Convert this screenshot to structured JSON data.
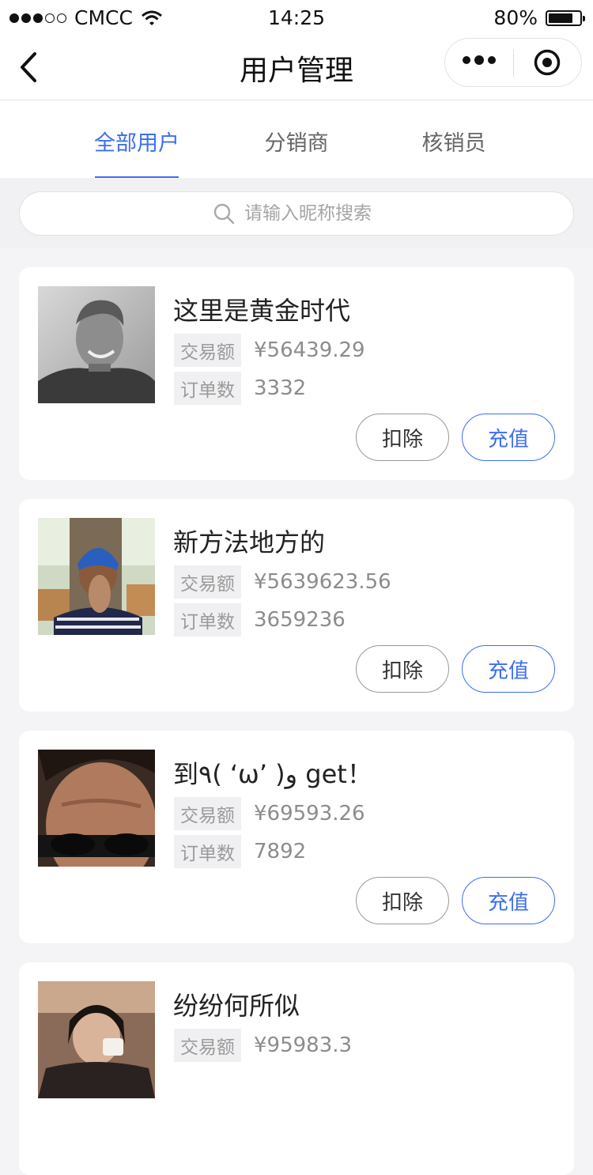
{
  "status_bar": {
    "carrier": "CMCC",
    "time": "14:25",
    "battery": "80%",
    "battery_level": 0.8
  },
  "nav": {
    "title": "用户管理",
    "back_icon": "chevron-left-icon",
    "more_icon": "more-dots-icon",
    "close_icon": "target-circle-icon"
  },
  "tabs": [
    {
      "label": "全部用户",
      "active": true
    },
    {
      "label": "分销商",
      "active": false
    },
    {
      "label": "核销员",
      "active": false
    }
  ],
  "search": {
    "placeholder": "请输入昵称搜索",
    "icon": "search-icon"
  },
  "labels": {
    "amount": "交易额",
    "orders": "订单数",
    "deduct": "扣除",
    "recharge": "充值"
  },
  "users": [
    {
      "name": "这里是黄金时代",
      "amount": "¥56439.29",
      "orders": "3332"
    },
    {
      "name": "新方法地方的",
      "amount": "¥5639623.56",
      "orders": "3659236"
    },
    {
      "name": "到٩( ‘ω’ )و get！",
      "amount": "¥69593.26",
      "orders": "7892"
    },
    {
      "name": "纷纷何所似",
      "amount": "¥95983.3",
      "orders": ""
    }
  ],
  "colors": {
    "accent": "#3c6ef0",
    "background": "#f4f4f6"
  }
}
